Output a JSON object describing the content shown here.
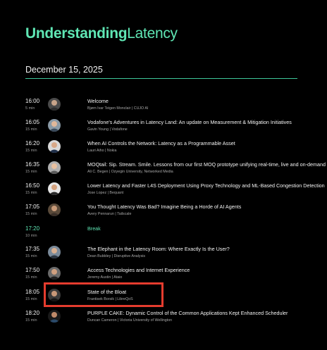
{
  "header": {
    "title_bold": "Understanding",
    "title_light": "Latency",
    "date": "December 15, 2025"
  },
  "colors": {
    "accent": "#5fe6b4",
    "highlight": "#e53c2e",
    "background": "#000000"
  },
  "sessions": [
    {
      "time": "16:00",
      "duration": "5 min",
      "title": "Welcome",
      "speaker": "Bjørn Ivar Teigen Monclair | CUJO AI"
    },
    {
      "time": "16:05",
      "duration": "15 min",
      "title": "Vodafone's Adventures in Latency Land: An update on Measurement & Mitigation Initiatives",
      "speaker": "Gavin Young | Vodafone"
    },
    {
      "time": "16:20",
      "duration": "15 min",
      "title": "When AI Controls the Network: Latency as a Programmable Asset",
      "speaker": "Lauri Aiho | Nokia"
    },
    {
      "time": "16:35",
      "duration": "15 min",
      "title": "MOQtail: Sip. Stream. Smile. Lessons from our first MOQ prototype unifying real-time, live and on-demand",
      "speaker": "Ali C. Begen | Ozyegin University, Networked Media"
    },
    {
      "time": "16:50",
      "duration": "15 min",
      "title": "Lower Latency and Faster L4S Deployment Using Proxy Technology and ML-Based Congestion Detection",
      "speaker": "Jose Lopez | Bequant"
    },
    {
      "time": "17:05",
      "duration": "15 min",
      "title": "You Thought Latency Was Bad? Imagine Being a Horde of AI Agents",
      "speaker": "Avery Pennarun | Tailscale"
    },
    {
      "time": "17:20",
      "duration": "10 min",
      "title": "Break",
      "speaker": ""
    },
    {
      "time": "17:35",
      "duration": "15 min",
      "title": "The Elephant in the Latency Room: Where Exactly Is the User?",
      "speaker": "Dean Bubbley | Disruptive Analysis"
    },
    {
      "time": "17:50",
      "duration": "15 min",
      "title": "Access Technologies and Internet Experience",
      "speaker": "Jeremy Austin | Ataio"
    },
    {
      "time": "18:05",
      "duration": "15 min",
      "title": "State of the Bloat",
      "speaker": "Frantisek Borsik | LibreQoS"
    },
    {
      "time": "18:20",
      "duration": "15 min",
      "title": "PURPLE CAKE: Dynamic Control of the Common Applications Kept Enhanced Scheduler",
      "speaker": "Duncan Cameron | Victoria University of Wellington"
    }
  ]
}
